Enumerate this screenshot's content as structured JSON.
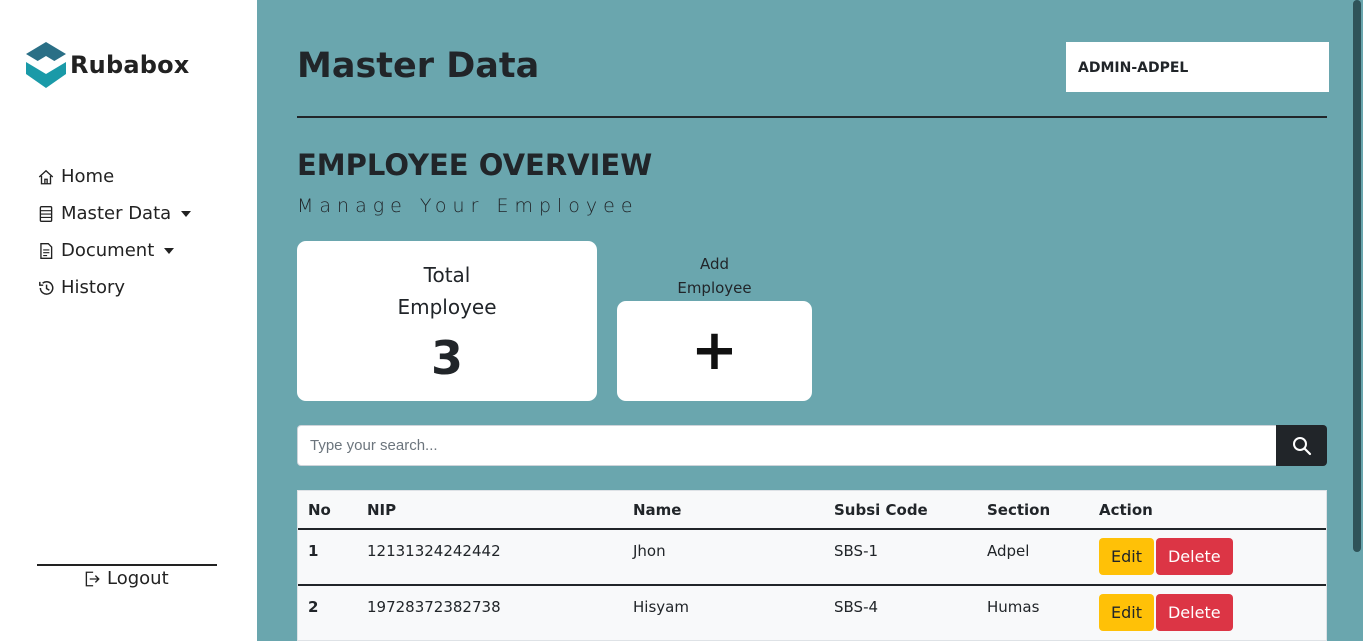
{
  "brand": {
    "name": "Rubabox",
    "logo_icon": "cube-logo-icon"
  },
  "sidebar": {
    "items": [
      {
        "label": "Home",
        "icon": "house-icon",
        "dropdown": false
      },
      {
        "label": "Master Data",
        "icon": "database-icon",
        "dropdown": true
      },
      {
        "label": "Document",
        "icon": "document-icon",
        "dropdown": true
      },
      {
        "label": "History",
        "icon": "history-icon",
        "dropdown": false
      }
    ],
    "logout_label": "Logout"
  },
  "header": {
    "title": "Master Data",
    "user": "ADMIN-ADPEL"
  },
  "overview": {
    "title": "EMPLOYEE OVERVIEW",
    "subtitle": "Manage Your Employee"
  },
  "cards": {
    "total_label_1": "Total",
    "total_label_2": "Employee",
    "total_value": "3",
    "add_label_1": "Add",
    "add_label_2": "Employee",
    "add_symbol": "+"
  },
  "search": {
    "placeholder": "Type your search..."
  },
  "table": {
    "columns": [
      "No",
      "NIP",
      "Name",
      "Subsi Code",
      "Section",
      "Action"
    ],
    "rows": [
      {
        "no": "1",
        "nip": "12131324242442",
        "name": "Jhon",
        "subsi": "SBS-1",
        "section": "Adpel"
      },
      {
        "no": "2",
        "nip": "19728372382738",
        "name": "Hisyam",
        "subsi": "SBS-4",
        "section": "Humas"
      }
    ],
    "edit_label": "Edit",
    "delete_label": "Delete"
  },
  "colors": {
    "background": "#6aa6ae",
    "logo": "#1a8c9a",
    "edit": "#ffc107",
    "delete": "#dc3545"
  }
}
